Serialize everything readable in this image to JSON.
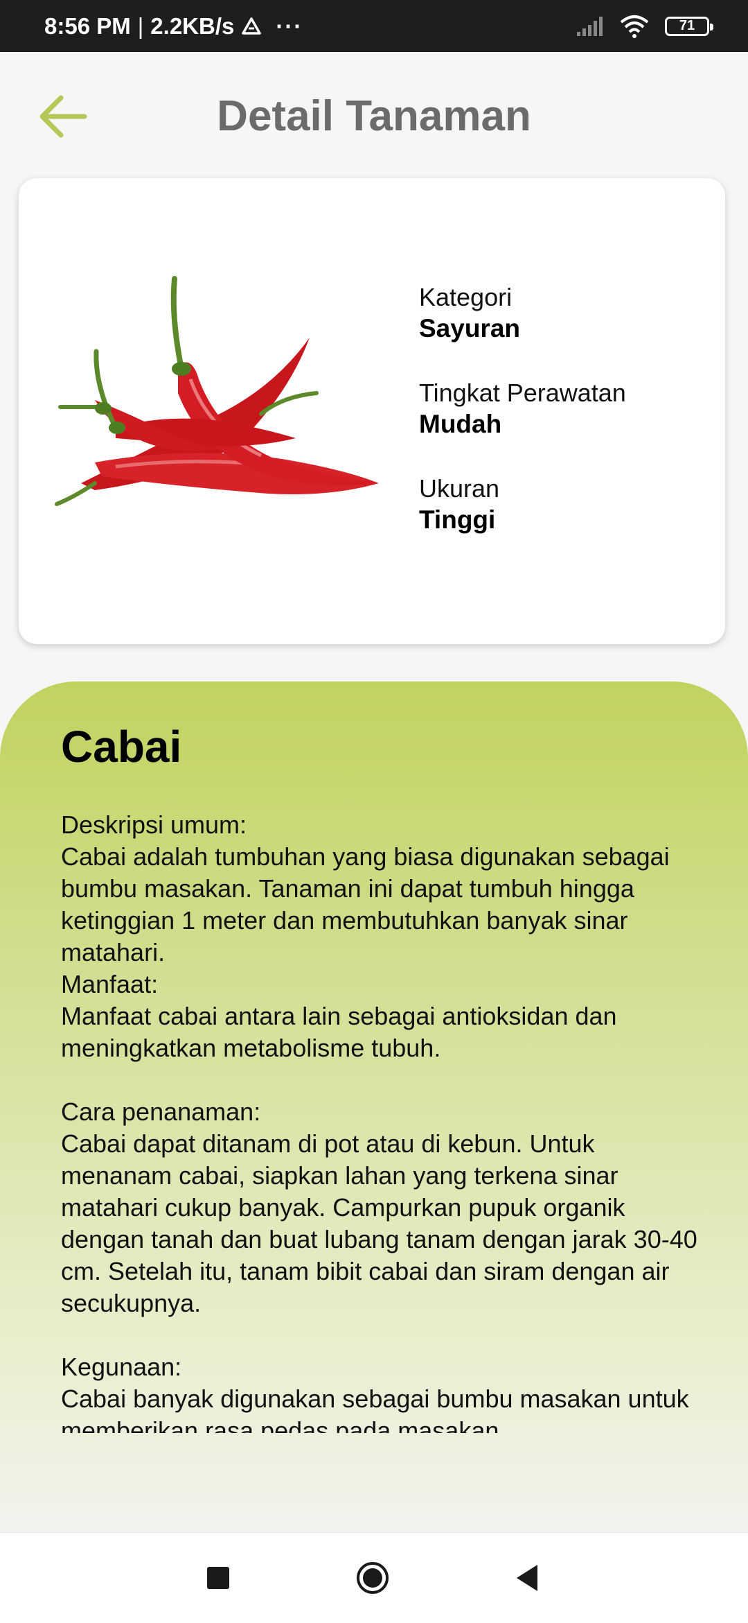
{
  "status_bar": {
    "time": "8:56 PM",
    "separator": "|",
    "speed": "2.2KB/s",
    "more": "···",
    "battery": "71",
    "icons": [
      "drive-icon",
      "signal-icon",
      "wifi-icon",
      "battery-icon"
    ]
  },
  "header": {
    "title": "Detail Tanaman",
    "back_icon": "arrow-left-icon",
    "accent_color": "#b5c95a"
  },
  "plant_card": {
    "image": "chili-pepper-image",
    "attributes": [
      {
        "label": "Kategori",
        "value": "Sayuran"
      },
      {
        "label": "Tingkat Perawatan",
        "value": "Mudah"
      },
      {
        "label": "Ukuran",
        "value": "Tinggi"
      }
    ]
  },
  "detail": {
    "name": "Cabai",
    "description": "Deskripsi umum:\nCabai adalah tumbuhan yang biasa digunakan sebagai bumbu masakan. Tanaman ini dapat tumbuh hingga ketinggian 1 meter dan membutuhkan banyak sinar matahari.\nManfaat:\nManfaat cabai antara lain sebagai antioksidan dan meningkatkan metabolisme tubuh.\n\nCara penanaman:\nCabai dapat ditanam di pot atau di kebun. Untuk menanam cabai, siapkan lahan yang terkena sinar matahari cukup banyak. Campurkan pupuk organik dengan tanah dan buat lubang tanam dengan jarak 30-40 cm. Setelah itu, tanam bibit cabai dan siram dengan air secukupnya.\n\nKegunaan:\nCabai banyak digunakan sebagai bumbu masakan untuk memberikan rasa pedas pada masakan.",
    "panel_color_top": "#c2d25e"
  },
  "nav_bar": {
    "icons": [
      "recents-square-icon",
      "home-circle-icon",
      "back-triangle-icon"
    ]
  }
}
